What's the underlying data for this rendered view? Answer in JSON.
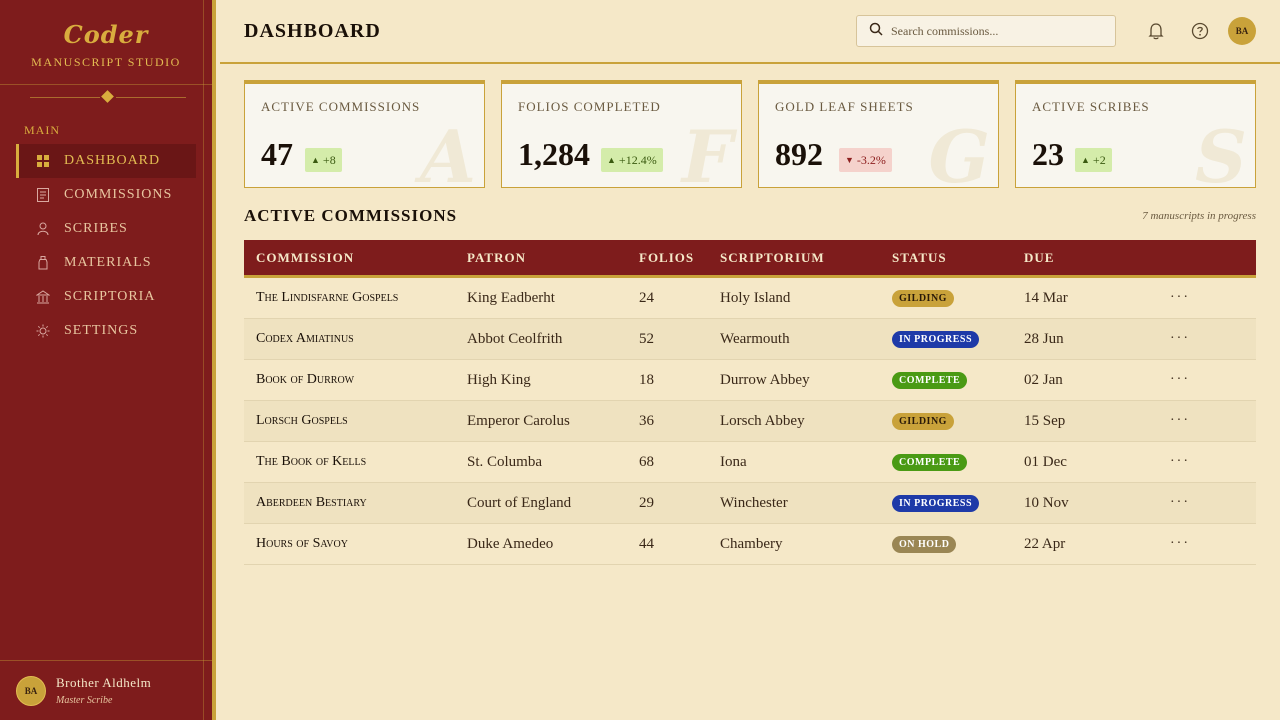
{
  "brand": {
    "logo": "Coder",
    "tagline": "Manuscript Studio"
  },
  "sidebar": {
    "section_label": "Main",
    "items": [
      {
        "label": "Dashboard",
        "icon": "grid-icon",
        "active": true
      },
      {
        "label": "Commissions",
        "icon": "document-icon"
      },
      {
        "label": "Scribes",
        "icon": "person-icon"
      },
      {
        "label": "Materials",
        "icon": "bottle-icon"
      },
      {
        "label": "Scriptoria",
        "icon": "building-icon"
      },
      {
        "label": "Settings",
        "icon": "gear-icon"
      }
    ],
    "user": {
      "initials": "BA",
      "name": "Brother Aldhelm",
      "role": "Master Scribe"
    }
  },
  "header": {
    "title": "DASHBOARD",
    "search_placeholder": "Search commissions...",
    "avatar_initials": "BA"
  },
  "cards": [
    {
      "label": "Active Commissions",
      "value": "47",
      "delta": "+8",
      "trend": "up",
      "letter": "A"
    },
    {
      "label": "Folios Completed",
      "value": "1,284",
      "delta": "+12.4%",
      "trend": "up",
      "letter": "F"
    },
    {
      "label": "Gold Leaf Sheets",
      "value": "892",
      "delta": "-3.2%",
      "trend": "down",
      "letter": "G"
    },
    {
      "label": "Active Scribes",
      "value": "23",
      "delta": "+2",
      "trend": "up",
      "letter": "S"
    }
  ],
  "section": {
    "title": "Active Commissions",
    "note": "7 manuscripts in progress"
  },
  "table": {
    "columns": [
      "Commission",
      "Patron",
      "Folios",
      "Scriptorium",
      "Status",
      "Due"
    ],
    "rows": [
      {
        "commission": "The Lindisfarne Gospels",
        "patron": "King Eadberht",
        "folios": "24",
        "scriptorium": "Holy Island",
        "status": "Gilding",
        "due": "14 Mar"
      },
      {
        "commission": "Codex Amiatinus",
        "patron": "Abbot Ceolfrith",
        "folios": "52",
        "scriptorium": "Wearmouth",
        "status": "In Progress",
        "due": "28 Jun"
      },
      {
        "commission": "Book of Durrow",
        "patron": "High King",
        "folios": "18",
        "scriptorium": "Durrow Abbey",
        "status": "Complete",
        "due": "02 Jan"
      },
      {
        "commission": "Lorsch Gospels",
        "patron": "Emperor Carolus",
        "folios": "36",
        "scriptorium": "Lorsch Abbey",
        "status": "Gilding",
        "due": "15 Sep"
      },
      {
        "commission": "The Book of Kells",
        "patron": "St. Columba",
        "folios": "68",
        "scriptorium": "Iona",
        "status": "Complete",
        "due": "01 Dec"
      },
      {
        "commission": "Aberdeen Bestiary",
        "patron": "Court of England",
        "folios": "29",
        "scriptorium": "Winchester",
        "status": "In Progress",
        "due": "10 Nov"
      },
      {
        "commission": "Hours of Savoy",
        "patron": "Duke Amedeo",
        "folios": "44",
        "scriptorium": "Chambery",
        "status": "On Hold",
        "due": "22 Apr"
      }
    ],
    "row_action": "···"
  },
  "colors": {
    "sidebar": "#7e1c1c",
    "gold": "#c9a23a",
    "parchment": "#f5e8c8"
  }
}
